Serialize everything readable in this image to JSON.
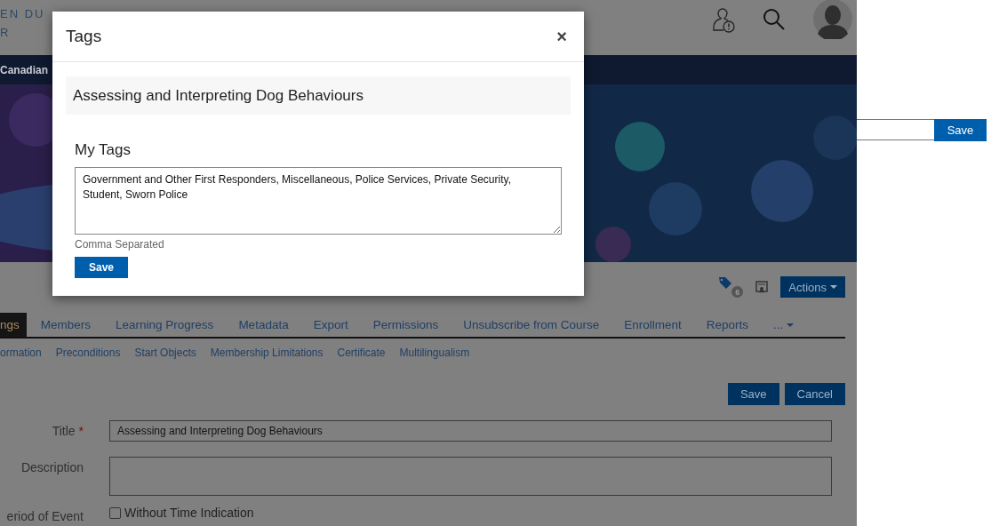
{
  "header": {
    "logo_lines": [
      "EN DU",
      "R"
    ]
  },
  "nav_bar": {
    "text": "Canadian"
  },
  "banner": {
    "kind": "picture"
  },
  "toolbar": {
    "tag_count": "6",
    "actions_button": "Actions"
  },
  "tabs": [
    {
      "label": "ngs",
      "selected": true,
      "kind": "tab"
    },
    {
      "label": "Members",
      "selected": false,
      "kind": "tab"
    },
    {
      "label": "Learning Progress",
      "selected": false,
      "kind": "tab"
    },
    {
      "label": "Metadata",
      "selected": false,
      "kind": "tab"
    },
    {
      "label": "Export",
      "selected": false,
      "kind": "tab"
    },
    {
      "label": "Permissions",
      "selected": false,
      "kind": "tab"
    },
    {
      "label": "Unsubscribe from Course",
      "selected": false,
      "kind": "tab"
    },
    {
      "label": "Enrollment",
      "selected": false,
      "kind": "tab"
    },
    {
      "label": "Reports",
      "selected": false,
      "kind": "tab"
    },
    {
      "label": "...",
      "selected": false,
      "kind": "more"
    }
  ],
  "subtabs": [
    "ormation",
    "Preconditions",
    "Start Objects",
    "Membership Limitations",
    "Certificate",
    "Multilingualism"
  ],
  "form_buttons": [
    "Save",
    "Cancel"
  ],
  "fields": [
    {
      "label": "Title",
      "required_mark": "*",
      "kind": "text",
      "value": "Assessing and Interpreting Dog Behaviours"
    },
    {
      "label": "Description",
      "kind": "textarea"
    },
    {
      "label": "eriod of Event",
      "kind": "checkbox",
      "option": "Without Time Indication",
      "checked": false
    }
  ],
  "modal": {
    "title": "Tags",
    "close": "×",
    "object_title": "Assessing and Interpreting Dog Behaviours",
    "section_title": "My Tags",
    "tags_value": "Government and Other First Responders, Miscellaneous, Police Services, Private Security, Student, Sworn Police",
    "hint": "Comma Separated",
    "save_button": "Save"
  },
  "side_form": {
    "save_button": "Save"
  }
}
